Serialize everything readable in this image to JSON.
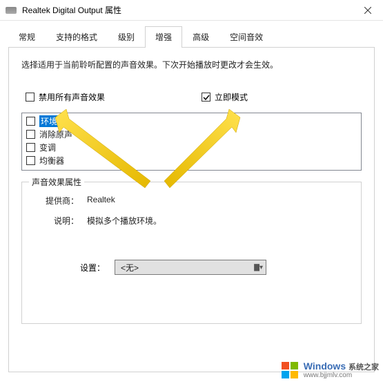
{
  "window": {
    "title": "Realtek Digital Output 属性"
  },
  "tabs": {
    "items": [
      {
        "label": "常规"
      },
      {
        "label": "支持的格式"
      },
      {
        "label": "级别"
      },
      {
        "label": "增强"
      },
      {
        "label": "高级"
      },
      {
        "label": "空间音效"
      }
    ],
    "active_index": 3
  },
  "description": "选择适用于当前聆听配置的声音效果。下次开始播放时更改才会生效。",
  "checkboxes": {
    "disable_all": {
      "label": "禁用所有声音效果",
      "checked": false
    },
    "immediate_mode": {
      "label": "立即模式",
      "checked": true
    }
  },
  "effect_list": [
    {
      "label": "环境",
      "checked": false,
      "selected": true
    },
    {
      "label": "消除原声",
      "checked": false,
      "selected": false
    },
    {
      "label": "变调",
      "checked": false,
      "selected": false
    },
    {
      "label": "均衡器",
      "checked": false,
      "selected": false
    }
  ],
  "properties": {
    "group_title": "声音效果属性",
    "provider_label": "提供商：",
    "provider_value": "Realtek",
    "desc_label": "说明：",
    "desc_value": "模拟多个播放环境。"
  },
  "settings": {
    "label": "设置：",
    "selected": "<无>"
  },
  "watermark": {
    "brand": "Windows",
    "sub": "系统之家",
    "url": "www.bjjmlv.com"
  }
}
